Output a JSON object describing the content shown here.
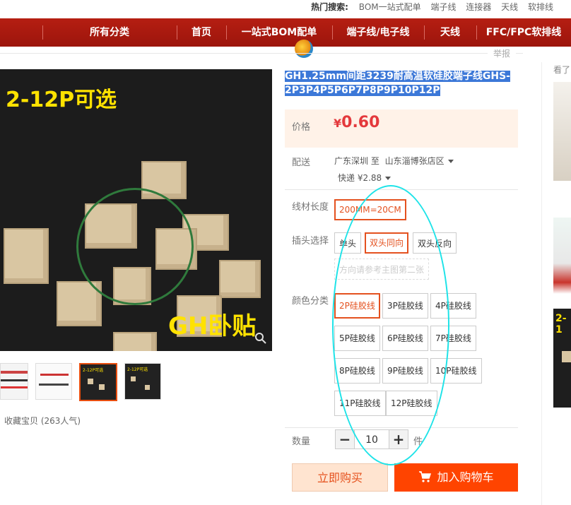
{
  "topbar": {
    "hot_label": "热门搜索:",
    "keywords": [
      "BOM一站式配单",
      "端子线",
      "连接器",
      "天线",
      "软排线"
    ]
  },
  "nav": {
    "items": [
      "所有分类",
      "首页",
      "一站式BOM配单",
      "端子线/电子线",
      "天线",
      "FFC/FPC软排线"
    ]
  },
  "report_label": "举报",
  "gallery": {
    "main_text_top": "2-12P可选",
    "main_text_bottom": "GH卧贴",
    "thumb_labels": [
      "",
      "",
      "2-12P可选",
      "2-12P可选"
    ],
    "favorite_label": "收藏宝贝",
    "favorite_count": "(263人气)"
  },
  "product": {
    "title": "GH1.25mm间距3239耐高温软硅胶端子线GHS-2P3P4P5P6P7P8P9P10P12P",
    "price_label": "价格",
    "currency": "¥",
    "price": "0.60",
    "ship_label": "配送",
    "ship_from": "广东深圳 至",
    "ship_to": "山东淄博张店区",
    "express": "快递 ¥2.88",
    "length_label": "线材长度",
    "length_options": [
      "200MM=20CM"
    ],
    "plug_label": "插头选择",
    "plug_options": [
      "单头",
      "双头同向",
      "双头反向"
    ],
    "plug_note": "方向请参考主图第二张",
    "color_label": "颜色分类",
    "color_options": [
      "2P硅胶线",
      "3P硅胶线",
      "4P硅胶线",
      "5P硅胶线",
      "6P硅胶线",
      "7P硅胶线",
      "8P硅胶线",
      "9P硅胶线",
      "10P硅胶线",
      "11P硅胶线",
      "12P硅胶线"
    ],
    "qty_label": "数量",
    "qty_minus": "−",
    "qty_value": "10",
    "qty_plus": "+",
    "qty_unit": "件",
    "buy_now": "立即购买",
    "add_cart": "加入购物车"
  },
  "side": {
    "label": "看了",
    "thumb_text": "2-1"
  },
  "colors": {
    "nav_red": "#a4190f",
    "price_red": "#e4393c",
    "accent_orange": "#ff4400",
    "selected_border": "#e4511f",
    "annotation_cyan": "#1ee3e8",
    "title_highlight": "#3c78d8"
  }
}
